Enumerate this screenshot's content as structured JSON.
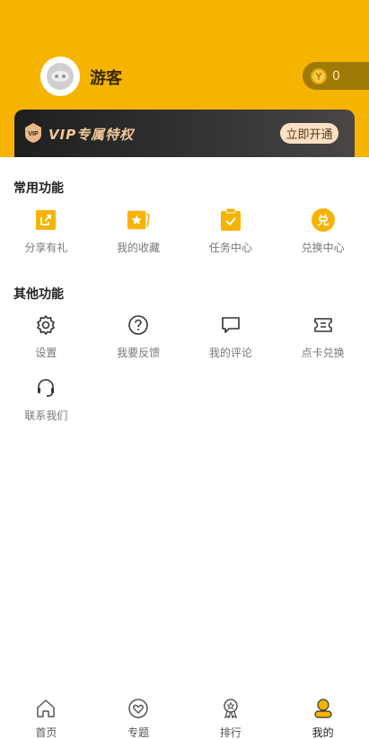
{
  "header": {
    "username": "游客",
    "coins": "0",
    "avatar_icon": "guest-avatar-icon",
    "background_color": "#f6b300"
  },
  "vip": {
    "title": "VIP专属特权",
    "button_label": "立即开通"
  },
  "common": {
    "title": "常用功能",
    "items": [
      {
        "label": "分享有礼",
        "icon": "share-icon"
      },
      {
        "label": "我的收藏",
        "icon": "star-icon"
      },
      {
        "label": "任务中心",
        "icon": "clipboard-check-icon"
      },
      {
        "label": "兑换中心",
        "icon": "exchange-icon",
        "glyph": "兑"
      }
    ]
  },
  "other": {
    "title": "其他功能",
    "items": [
      {
        "label": "设置",
        "icon": "gear-icon"
      },
      {
        "label": "我要反馈",
        "icon": "question-icon"
      },
      {
        "label": "我的评论",
        "icon": "comment-icon"
      },
      {
        "label": "点卡兑换",
        "icon": "ticket-icon"
      },
      {
        "label": "联系我们",
        "icon": "headset-icon"
      }
    ]
  },
  "tabbar": {
    "active_index": 3,
    "items": [
      {
        "label": "首页",
        "icon": "home-icon"
      },
      {
        "label": "专题",
        "icon": "heart-icon"
      },
      {
        "label": "排行",
        "icon": "medal-icon"
      },
      {
        "label": "我的",
        "icon": "user-icon"
      }
    ]
  }
}
